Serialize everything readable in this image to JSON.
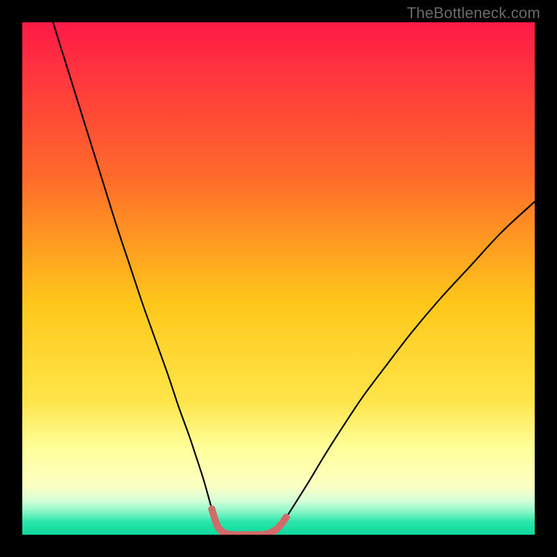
{
  "watermark": "TheBottleneck.com",
  "chart_data": {
    "type": "line",
    "title": "",
    "xlabel": "",
    "ylabel": "",
    "xlim": [
      0,
      100
    ],
    "ylim": [
      0,
      100
    ],
    "grid": false,
    "legend": false,
    "gradient_stops": [
      {
        "offset": 0.0,
        "color": "#ff1a47"
      },
      {
        "offset": 0.3,
        "color": "#ff6a2a"
      },
      {
        "offset": 0.55,
        "color": "#ffc81a"
      },
      {
        "offset": 0.74,
        "color": "#ffe54a"
      },
      {
        "offset": 0.83,
        "color": "#ffff9a"
      },
      {
        "offset": 0.905,
        "color": "#fdffc4"
      },
      {
        "offset": 0.935,
        "color": "#d2ffd6"
      },
      {
        "offset": 0.955,
        "color": "#88f5c8"
      },
      {
        "offset": 0.975,
        "color": "#29e6a8"
      },
      {
        "offset": 1.0,
        "color": "#0fd79c"
      }
    ],
    "series": [
      {
        "name": "bottleneck-curve-left",
        "stroke": "#000000",
        "stroke_width": 2.2,
        "points": [
          {
            "x": 6.0,
            "y": 100.0
          },
          {
            "x": 8.5,
            "y": 92.0
          },
          {
            "x": 11.0,
            "y": 84.0
          },
          {
            "x": 13.5,
            "y": 76.0
          },
          {
            "x": 16.0,
            "y": 68.0
          },
          {
            "x": 18.5,
            "y": 60.0
          },
          {
            "x": 21.0,
            "y": 52.5
          },
          {
            "x": 23.5,
            "y": 45.0
          },
          {
            "x": 26.0,
            "y": 38.0
          },
          {
            "x": 28.5,
            "y": 31.0
          },
          {
            "x": 30.5,
            "y": 25.0
          },
          {
            "x": 32.5,
            "y": 19.5
          },
          {
            "x": 34.0,
            "y": 15.0
          },
          {
            "x": 35.3,
            "y": 11.0
          },
          {
            "x": 36.3,
            "y": 7.5
          },
          {
            "x": 37.0,
            "y": 5.0
          },
          {
            "x": 37.6,
            "y": 3.0
          },
          {
            "x": 38.2,
            "y": 1.5
          },
          {
            "x": 39.0,
            "y": 0.6
          },
          {
            "x": 40.0,
            "y": 0.15
          },
          {
            "x": 41.5,
            "y": 0.0
          }
        ]
      },
      {
        "name": "bottleneck-curve-right",
        "stroke": "#000000",
        "stroke_width": 2.2,
        "points": [
          {
            "x": 46.5,
            "y": 0.0
          },
          {
            "x": 48.0,
            "y": 0.15
          },
          {
            "x": 49.0,
            "y": 0.6
          },
          {
            "x": 50.0,
            "y": 1.5
          },
          {
            "x": 51.5,
            "y": 3.4
          },
          {
            "x": 53.5,
            "y": 6.5
          },
          {
            "x": 56.0,
            "y": 10.5
          },
          {
            "x": 59.0,
            "y": 15.5
          },
          {
            "x": 62.5,
            "y": 21.0
          },
          {
            "x": 66.5,
            "y": 27.0
          },
          {
            "x": 71.0,
            "y": 33.0
          },
          {
            "x": 76.0,
            "y": 39.5
          },
          {
            "x": 81.5,
            "y": 46.0
          },
          {
            "x": 87.5,
            "y": 52.5
          },
          {
            "x": 93.5,
            "y": 59.0
          },
          {
            "x": 100.0,
            "y": 65.0
          }
        ]
      },
      {
        "name": "bottom-marker-strip",
        "stroke": "#d36a6a",
        "stroke_width": 10,
        "marker_radius": 5.2,
        "points": [
          {
            "x": 37.0,
            "y": 5.0
          },
          {
            "x": 37.6,
            "y": 3.0
          },
          {
            "x": 38.2,
            "y": 1.5
          },
          {
            "x": 39.0,
            "y": 0.6
          },
          {
            "x": 40.0,
            "y": 0.15
          },
          {
            "x": 41.5,
            "y": 0.0
          },
          {
            "x": 43.0,
            "y": 0.0
          },
          {
            "x": 44.5,
            "y": 0.0
          },
          {
            "x": 46.0,
            "y": 0.0
          },
          {
            "x": 47.5,
            "y": 0.1
          },
          {
            "x": 48.5,
            "y": 0.4
          },
          {
            "x": 49.5,
            "y": 1.0
          },
          {
            "x": 50.5,
            "y": 2.0
          },
          {
            "x": 51.5,
            "y": 3.4
          }
        ]
      }
    ]
  }
}
